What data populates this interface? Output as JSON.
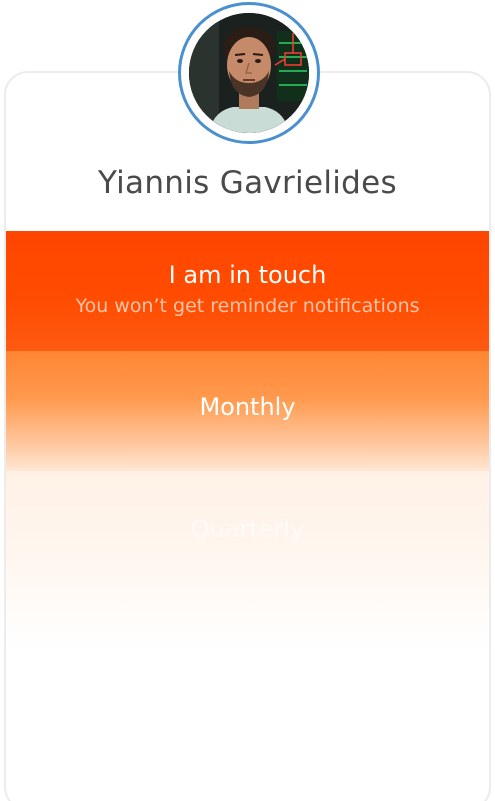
{
  "contact": {
    "name": "Yiannis Gavrielides",
    "avatar": "profile-photo"
  },
  "frequency_options": [
    {
      "label": "I am in touch",
      "sublabel": "You won’t get reminder notifications",
      "selected": true,
      "color": "#ff4500"
    },
    {
      "label": "Monthly",
      "selected": false,
      "color": "#ff8533"
    },
    {
      "label": "Quarterly",
      "selected": false,
      "color": "#fff1e6"
    }
  ],
  "colors": {
    "avatar_ring": "#4a90cf",
    "name_text": "#4a4a4a",
    "card_border": "#ececec"
  }
}
